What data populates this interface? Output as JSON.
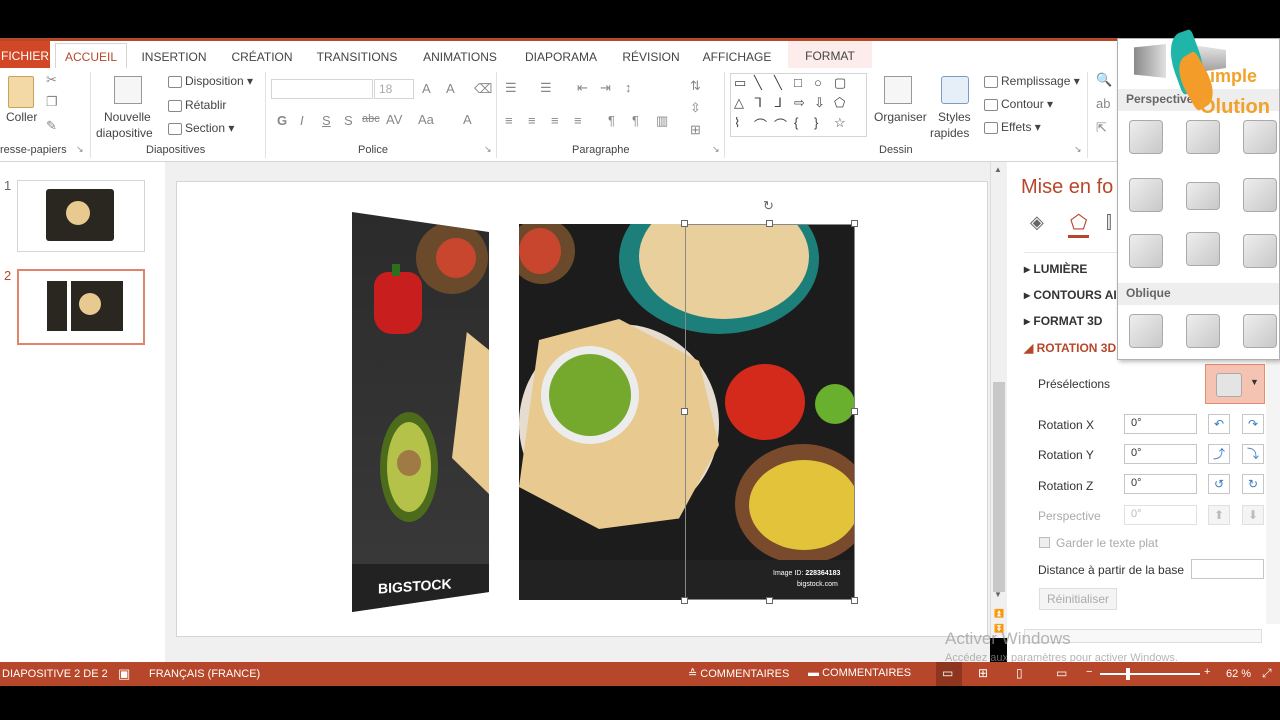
{
  "tabs": {
    "file": "FICHIER",
    "home": "ACCUEIL",
    "insert": "INSERTION",
    "design": "CRÉATION",
    "transitions": "TRANSITIONS",
    "animations": "ANIMATIONS",
    "slideshow": "DIAPORAMA",
    "review": "RÉVISION",
    "view": "AFFICHAGE",
    "format": "FORMAT"
  },
  "ribbon": {
    "clipboard": {
      "paste": "Coller",
      "label": "resse-papiers"
    },
    "slides": {
      "new_slide_1": "Nouvelle",
      "new_slide_2": "diapositive",
      "layout": "Disposition",
      "reset": "Rétablir",
      "section": "Section",
      "label": "Diapositives"
    },
    "font": {
      "size": "18",
      "label": "Police"
    },
    "paragraph": {
      "label": "Paragraphe"
    },
    "drawing": {
      "arrange": "Organiser",
      "quick_styles_1": "Styles",
      "quick_styles_2": "rapides",
      "fill": "Remplissage",
      "outline": "Contour",
      "effects": "Effets",
      "label": "Dessin"
    }
  },
  "slides_pane": {
    "slide1_num": "1",
    "slide2_num": "2"
  },
  "format_pane": {
    "title": "Mise en fo",
    "sections": {
      "light": "LUMIÈRE",
      "contours": "CONTOURS AI",
      "format3d": "FORMAT 3D",
      "rotation3d": "ROTATION 3D"
    },
    "presets_label": "Présélections",
    "rotation_x_label": "Rotation X",
    "rotation_x": "0°",
    "rotation_y_label": "Rotation Y",
    "rotation_y": "0°",
    "rotation_z_label": "Rotation Z",
    "rotation_z": "0°",
    "perspective_label": "Perspective",
    "perspective": "0°",
    "keep_flat": "Garder le texte plat",
    "distance_label": "Distance à partir de la base",
    "reset": "Réinitialiser"
  },
  "gallery": {
    "perspective": "Perspective",
    "oblique": "Oblique"
  },
  "logo": {
    "line1": "imple",
    "line2": "Olution"
  },
  "slide_content": {
    "brand": "BIGSTOCK",
    "image_id_label": "Image ID:",
    "image_id": "228364183",
    "site": "bigstock.com"
  },
  "status": {
    "slide_info": "DIAPOSITIVE 2 DE 2",
    "language": "FRANÇAIS (FRANCE)",
    "notes": "COMMENTAIRES",
    "comments": "COMMENTAIRES",
    "zoom": "62 %"
  },
  "watermark": {
    "line1": "Activer Windows",
    "line2": "Accédez aux paramètres pour activer Windows."
  },
  "colors": {
    "accent": "#b7472a",
    "file_tab": "#d24726",
    "format_tab": "#fdecec",
    "text_accent": "#b7472a"
  }
}
